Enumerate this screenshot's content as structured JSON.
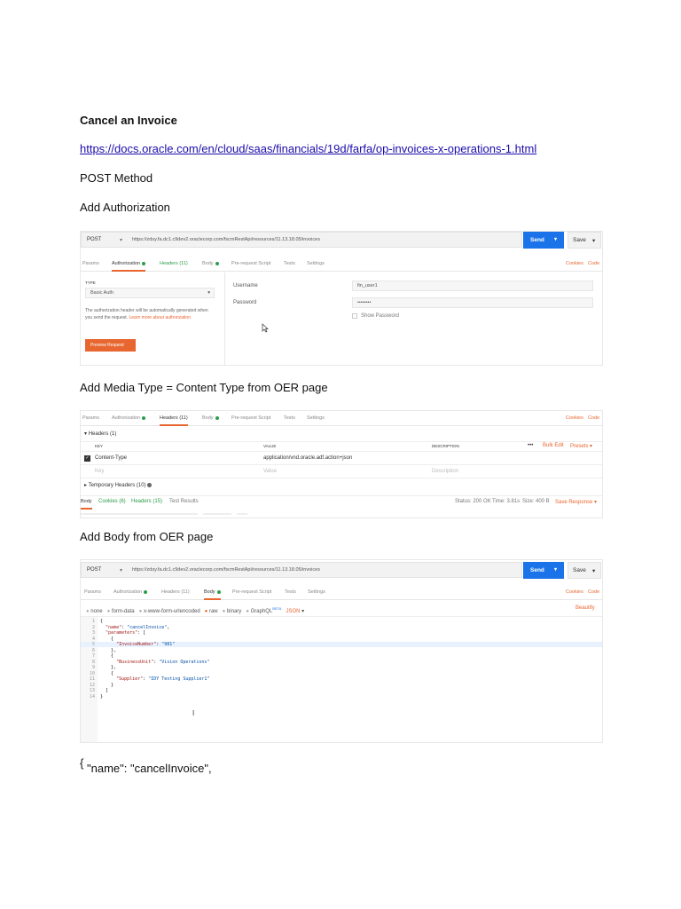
{
  "doc": {
    "title": "Cancel an Invoice",
    "link": "https://docs.oracle.com/en/cloud/saas/financials/19d/farfa/op-invoices-x-operations-1.html",
    "method_text": "POST Method",
    "step_auth": "Add Authorization",
    "step_media": "Add Media Type = Content Type from OER page",
    "step_body": "Add Body from OER page",
    "json_open": "{",
    "json_first_line": "\"name\": \"cancelInvoice\","
  },
  "shot1": {
    "method": "POST",
    "url": "https://zdsy.fa.dc1.c9dev2.oraclecorp.com/fscmRestApi/resources/11.13.18.05/invoices",
    "send": "Send",
    "save": "Save",
    "tabs": [
      "Params",
      "Authorization",
      "Headers (11)",
      "Body",
      "Pre-request Script",
      "Tests",
      "Settings"
    ],
    "cookies": "Cookies",
    "code": "Code",
    "type_label": "TYPE",
    "type_value": "Basic Auth",
    "auth_help": "The authorization header will be automatically generated when you send the request.",
    "learn_more": "Learn more about authorization",
    "preview_btn": "Preview Request",
    "username_label": "Username",
    "username_value": "fin_user1",
    "password_label": "Password",
    "password_value": "••••••••",
    "show_password": "Show Password"
  },
  "shot2": {
    "tabs": [
      "Params",
      "Authorization",
      "Headers (11)",
      "Body",
      "Pre-request Script",
      "Tests",
      "Settings"
    ],
    "cookies": "Cookies",
    "code": "Code",
    "headers_toggle": "Headers (1)",
    "col_key": "KEY",
    "col_value": "VALUE",
    "col_desc": "DESCRIPTION",
    "more": "•••",
    "bulk_edit": "Bulk Edit",
    "presets": "Presets",
    "row_key": "Content-Type",
    "row_value": "application/vnd.oracle.adf.action+json",
    "ph_key": "Key",
    "ph_value": "Value",
    "ph_desc": "Description",
    "temp_headers": "Temporary Headers (10)",
    "resp_tabs": [
      "Body",
      "Cookies (6)",
      "Headers (15)",
      "Test Results"
    ],
    "status": "Status: 200 OK",
    "time": "Time: 3.81s",
    "size": "Size: 400 B",
    "save_response": "Save Response"
  },
  "shot3": {
    "method": "POST",
    "url": "https://zdsy.fa.dc1.c9dev2.oraclecorp.com/fscmRestApi/resources/11.13.18.05/invoices",
    "send": "Send",
    "save": "Save",
    "tabs": [
      "Params",
      "Authorization",
      "Headers (11)",
      "Body",
      "Pre-request Script",
      "Tests",
      "Settings"
    ],
    "cookies": "Cookies",
    "code": "Code",
    "body_types": [
      "none",
      "form-data",
      "x-www-form-urlencoded",
      "raw",
      "binary",
      "GraphQL"
    ],
    "beta": "BETA",
    "json": "JSON",
    "beautify": "Beautify",
    "line_numbers": [
      "1",
      "2",
      "3",
      "4",
      "5",
      "6",
      "7",
      "8",
      "9",
      "10",
      "11",
      "12",
      "13",
      "14"
    ],
    "code_lines": [
      "{",
      "  \"name\": \"cancelInvoice\",",
      "  \"parameters\": [",
      "    {",
      "      \"InvoiceNumber\": \"981\"",
      "    },",
      "    {",
      "      \"BusinessUnit\": \"Vision Operations\"",
      "    },",
      "    {",
      "      \"Supplier\": \"IDY Testing Supplier1\"",
      "    }",
      "  ]",
      "}"
    ]
  }
}
